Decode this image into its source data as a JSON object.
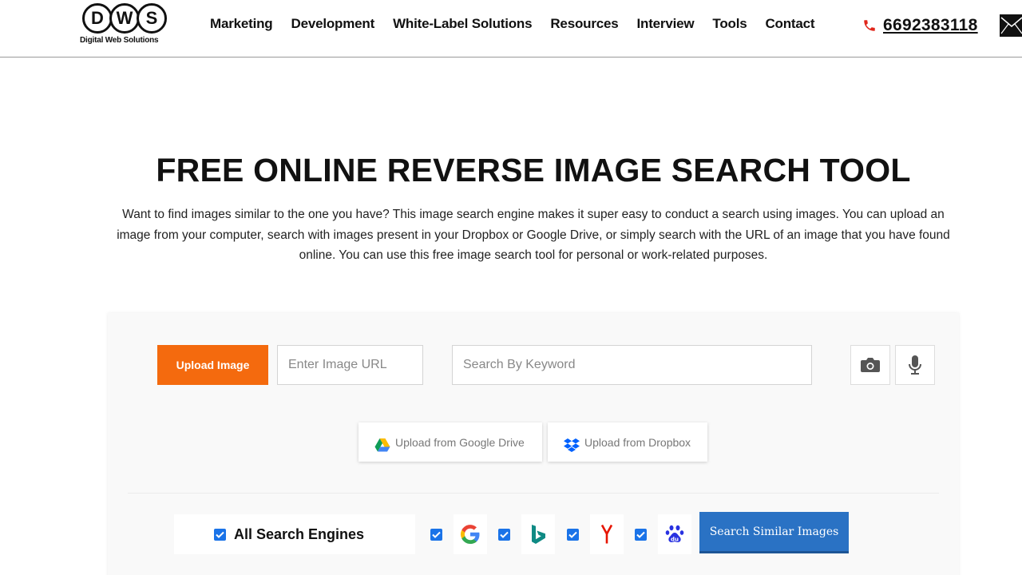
{
  "header": {
    "logo": {
      "letters": [
        "D",
        "W",
        "S"
      ],
      "subtitle": "Digital Web Solutions"
    },
    "nav": [
      {
        "label": "Marketing"
      },
      {
        "label": "Development"
      },
      {
        "label": "White-Label Solutions"
      },
      {
        "label": "Resources"
      },
      {
        "label": "Interview"
      },
      {
        "label": "Tools"
      },
      {
        "label": "Contact"
      }
    ],
    "phone": "6692383118",
    "icons": {
      "phone": "phone-icon",
      "mail": "mail-icon"
    }
  },
  "hero": {
    "title": "FREE ONLINE REVERSE IMAGE SEARCH TOOL",
    "description": "Want to find images similar to the one you have? This image search engine makes it super easy to conduct a search using images. You can upload an image from your computer, search with images present in your Dropbox or Google Drive, or simply search with the URL of an image that you have found online. You can use this free image search tool for personal or work-related purposes."
  },
  "tool": {
    "upload_label": "Upload Image",
    "url_placeholder": "Enter Image URL",
    "url_value": "",
    "keyword_placeholder": "Search By Keyword",
    "keyword_value": "",
    "gdrive_label": "Upload from Google Drive",
    "dropbox_label": "Upload from Dropbox",
    "engines_all_label": "All Search Engines",
    "engines": [
      {
        "name": "google",
        "checked": true,
        "icon": "google-logo-icon"
      },
      {
        "name": "bing",
        "checked": true,
        "icon": "bing-logo-icon"
      },
      {
        "name": "yandex",
        "checked": true,
        "icon": "yandex-logo-icon"
      },
      {
        "name": "baidu",
        "checked": true,
        "icon": "baidu-logo-icon"
      }
    ],
    "search_label": "Search Similar Images",
    "colors": {
      "upload": "#f46a0e",
      "search": "#2a72c4",
      "checkbox": "#1a73e8"
    }
  }
}
